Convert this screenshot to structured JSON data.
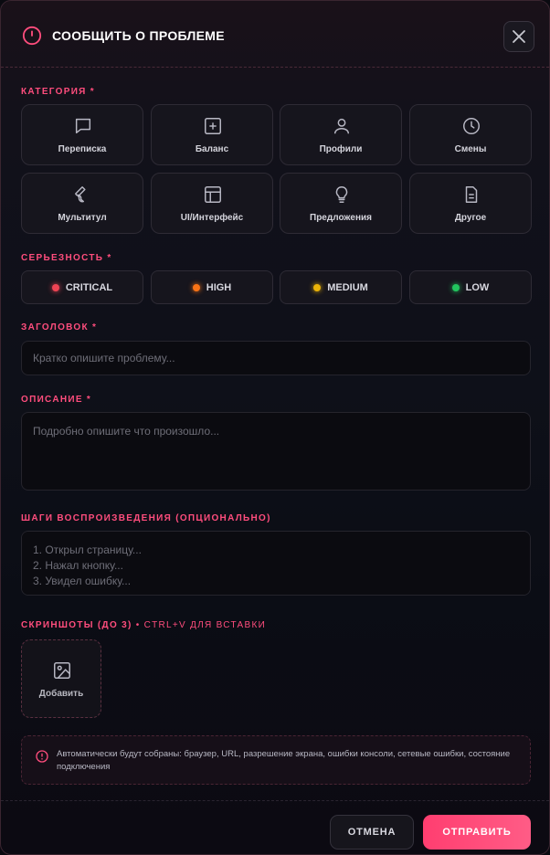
{
  "header": {
    "title": "СООБЩИТЬ О ПРОБЛЕМЕ",
    "icon": "alert-circle-icon"
  },
  "category": {
    "label": "КАТЕГОРИЯ *",
    "items": [
      {
        "label": "Переписка",
        "icon": "chat-icon"
      },
      {
        "label": "Баланс",
        "icon": "plus-square-icon"
      },
      {
        "label": "Профили",
        "icon": "user-icon"
      },
      {
        "label": "Смены",
        "icon": "clock-icon"
      },
      {
        "label": "Мультитул",
        "icon": "wrench-icon"
      },
      {
        "label": "UI/Интерфейс",
        "icon": "layout-icon"
      },
      {
        "label": "Предложения",
        "icon": "lightbulb-icon"
      },
      {
        "label": "Другое",
        "icon": "file-icon"
      }
    ]
  },
  "severity": {
    "label": "СЕРЬЕЗНОСТЬ *",
    "items": [
      {
        "label": "CRITICAL",
        "color": "#ef4454"
      },
      {
        "label": "HIGH",
        "color": "#f97316"
      },
      {
        "label": "MEDIUM",
        "color": "#eab308"
      },
      {
        "label": "LOW",
        "color": "#22c55e"
      }
    ]
  },
  "title_field": {
    "label": "ЗАГОЛОВОК *",
    "placeholder": "Кратко опишите проблему...",
    "value": ""
  },
  "description_field": {
    "label": "ОПИСАНИЕ *",
    "placeholder": "Подробно опишите что произошло...",
    "value": ""
  },
  "steps_field": {
    "label": "ШАГИ ВОСПРОИЗВЕДЕНИЯ (ОПЦИОНАЛЬНО)",
    "placeholder": "1. Открыл страницу...\n2. Нажал кнопку...\n3. Увидел ошибку...",
    "value": ""
  },
  "screenshots": {
    "label": "СКРИНШОТЫ (ДО 3)",
    "hint": " • CTRL+V ДЛЯ ВСТАВКИ",
    "add_label": "Добавить"
  },
  "info": {
    "text": "Автоматически будут собраны: браузер, URL, разрешение экрана, ошибки консоли, сетевые ошибки, состояние подключения"
  },
  "footer": {
    "cancel_label": "ОТМЕНА",
    "submit_label": "ОТПРАВИТЬ"
  },
  "colors": {
    "accent": "#ff4d7d",
    "submit": "#ff4675"
  }
}
